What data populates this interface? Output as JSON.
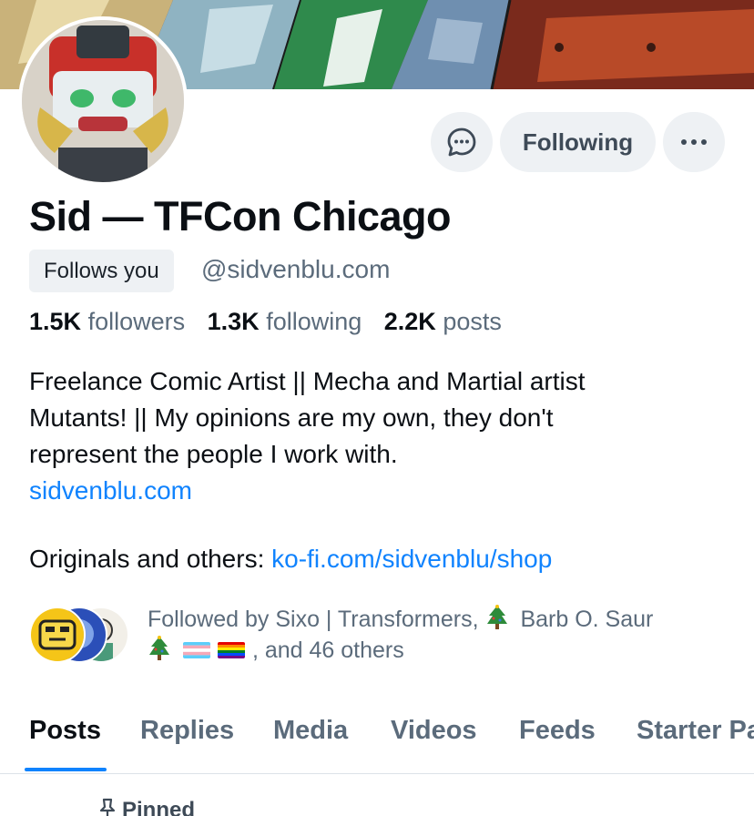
{
  "profile": {
    "display_name": "Sid — TFCon Chicago",
    "follows_you_label": "Follows you",
    "handle": "@sidvenblu.com"
  },
  "actions": {
    "message_icon": "chat-bubble-icon",
    "following_label": "Following",
    "more_icon": "ellipsis-icon"
  },
  "stats": {
    "followers_count": "1.5K",
    "followers_label": "followers",
    "following_count": "1.3K",
    "following_label": "following",
    "posts_count": "2.2K",
    "posts_label": "posts"
  },
  "bio": {
    "line1": "Freelance Comic Artist || Mecha and Martial artist",
    "line2": "Mutants! || My opinions are my own, they don't",
    "line3": "represent the people I work with.",
    "website_link": "sidvenblu.com",
    "originals_prefix": "Originals and others: ",
    "shop_link": "ko-fi.com/sidvenblu/shop"
  },
  "followed_by": {
    "line1": "Followed by Sixo | Transformers,",
    "name2": "Barb O. Saur",
    "line2_suffix": ", and 46 others",
    "emoji_icons": [
      "christmas-tree-icon",
      "trans-flag-icon",
      "rainbow-flag-icon"
    ]
  },
  "tabs": [
    {
      "label": "Posts",
      "active": true
    },
    {
      "label": "Replies",
      "active": false
    },
    {
      "label": "Media",
      "active": false
    },
    {
      "label": "Videos",
      "active": false
    },
    {
      "label": "Feeds",
      "active": false
    },
    {
      "label": "Starter Pa",
      "active": false
    }
  ],
  "feed": {
    "pinned_label": "Pinned",
    "pin_icon": "pin-icon"
  },
  "colors": {
    "link": "#1083fe",
    "muted_text": "#5b6b7b",
    "button_bg": "#eef1f4",
    "tab_underline": "#1083fe"
  }
}
